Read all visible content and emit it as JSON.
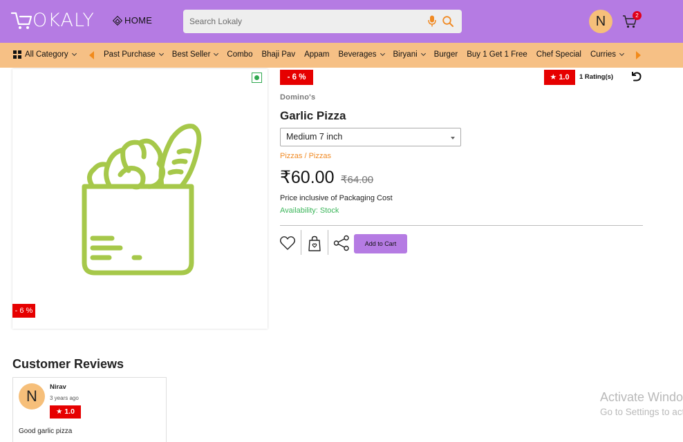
{
  "header": {
    "logo_text": "OKALY",
    "home_label": "HOME",
    "search_placeholder": "Search Lokaly",
    "user_initial": "N",
    "cart_count": "2",
    "brand_color": "#b57be3"
  },
  "category_bar": {
    "all_label": "All Category",
    "items": [
      {
        "label": "Past Purchase",
        "has_dropdown": true
      },
      {
        "label": "Best Seller",
        "has_dropdown": true
      },
      {
        "label": "Combo",
        "has_dropdown": false
      },
      {
        "label": "Bhaji Pav",
        "has_dropdown": false
      },
      {
        "label": "Appam",
        "has_dropdown": false
      },
      {
        "label": "Beverages",
        "has_dropdown": true
      },
      {
        "label": "Biryani",
        "has_dropdown": true
      },
      {
        "label": "Burger",
        "has_dropdown": false
      },
      {
        "label": "Buy 1 Get 1 Free",
        "has_dropdown": false
      },
      {
        "label": "Chef Special",
        "has_dropdown": false
      },
      {
        "label": "Curries",
        "has_dropdown": true
      }
    ],
    "bar_color": "#f6c085"
  },
  "product": {
    "image_discount": "- 6 %",
    "discount_badge": "- 6 %",
    "rating": "1.0",
    "rating_count": "1 Rating(s)",
    "brand": "Domino's",
    "title": "Garlic Pizza",
    "variant_selected": "Medium 7 inch",
    "breadcrumb": "Pizzas / Pizzas",
    "price": "₹60.00",
    "mrp": "₹64.00",
    "price_note": "Price inclusive of Packaging Cost",
    "availability": "Availability: Stock",
    "add_to_cart_label": "Add to Cart",
    "veg": true
  },
  "reviews": {
    "title": "Customer Reviews",
    "items": [
      {
        "initial": "N",
        "name": "Nirav",
        "time": "3 years ago",
        "rating": "1.0",
        "text": "Good garlic pizza"
      }
    ]
  },
  "watermark": {
    "title": "Activate Windows",
    "subtitle": "Go to Settings to activate Windows."
  }
}
